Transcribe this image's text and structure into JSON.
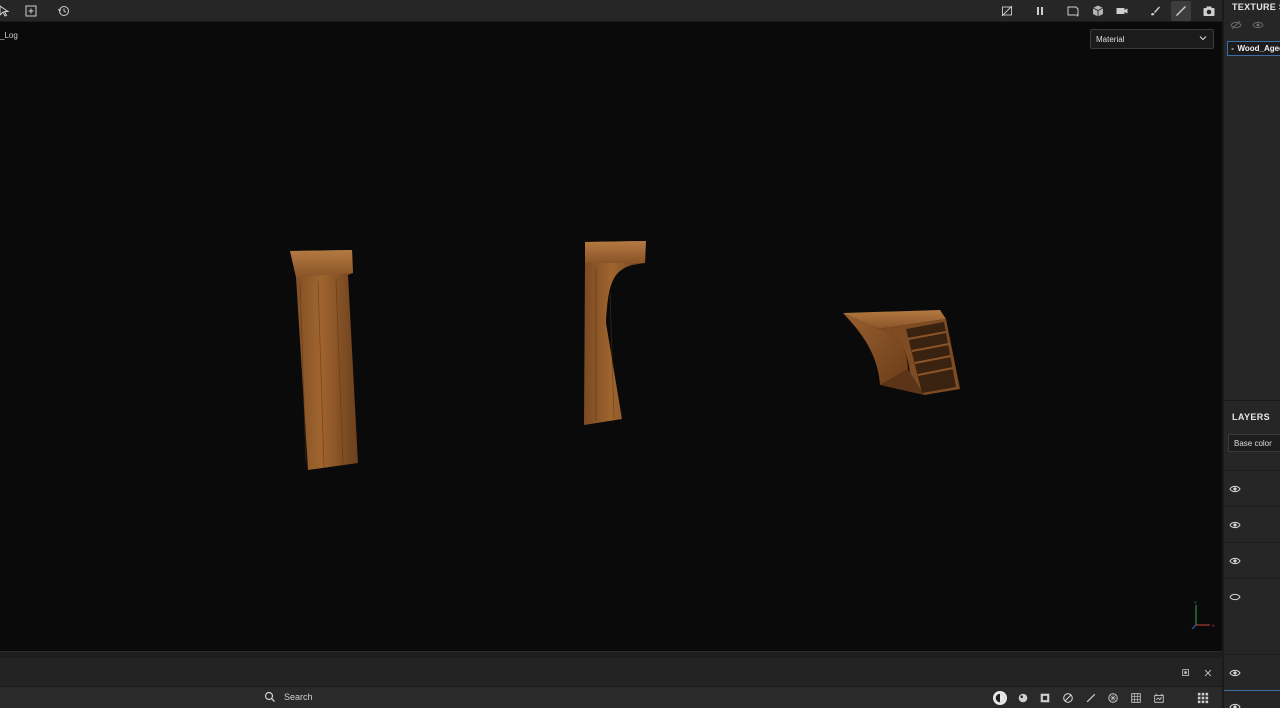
{
  "viewport": {
    "label": "_Log",
    "material_select": "Material"
  },
  "toolbar_left": {
    "icons": [
      "cursor-icon",
      "add-icon",
      "history-icon"
    ]
  },
  "toolbar_right": {
    "icons": [
      "hide-icon",
      "pause-icon",
      "camera-frame-icon",
      "cube-icon",
      "video-camera-icon",
      "brush-alt-icon",
      "paint-brush-icon",
      "screenshot-icon"
    ]
  },
  "right_panel": {
    "texture_set_title": "TEXTURE SET LIST",
    "texture_set_item": "Wood_Aged",
    "layers_title": "LAYERS",
    "channel_select": "Base color"
  },
  "bottombar": {
    "search_placeholder": "Search"
  },
  "colors": {
    "accent": "#3a6ea5",
    "panel": "#262626",
    "viewport": "#0a0a0a"
  }
}
